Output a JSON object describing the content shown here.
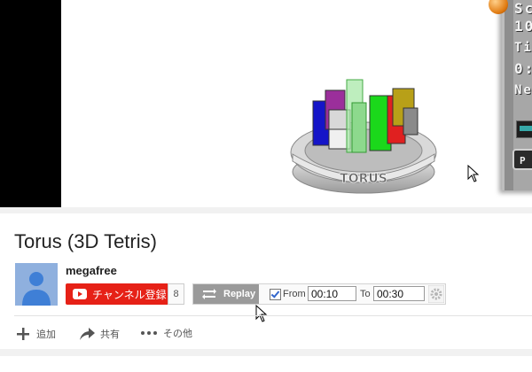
{
  "video": {
    "logo_text": "TORUS",
    "hud": {
      "line1": "Sc",
      "line2": "10",
      "line3": "Ti",
      "line4": "0:",
      "line5": "Ne",
      "button2_label": "P"
    }
  },
  "info": {
    "title": "Torus (3D Tetris)",
    "channel_name": "megafree",
    "subscribe_label": "チャンネル登録",
    "subscriber_count": "8"
  },
  "replay": {
    "button_label": "Replay",
    "checked": true,
    "from_label": "From",
    "from_value": "00:10",
    "to_label": "To",
    "to_value": "00:30"
  },
  "actions": {
    "add_label": "追加",
    "share_label": "共有",
    "more_label": "その他"
  },
  "colors": {
    "subscribe_red": "#e62117",
    "replay_gray": "#9a9a9a"
  }
}
